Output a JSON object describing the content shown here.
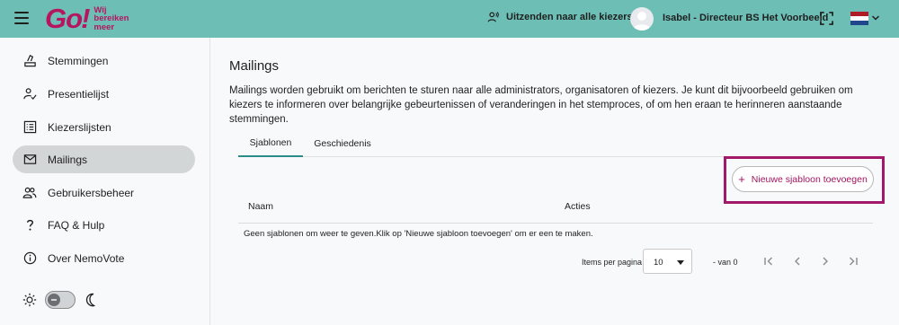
{
  "header": {
    "logo_main": "Go",
    "logo_bang": "!",
    "logo_tagline": [
      "Wij",
      "bereiken",
      "meer"
    ],
    "broadcast_label": "Uitzenden naar alle kiezers",
    "user_name": "Isabel - Directeur BS Het Voorbeeld",
    "language": "nl",
    "colors": {
      "bar": "#6dbfb6",
      "brand": "#b6155f"
    }
  },
  "sidebar": {
    "items": [
      {
        "label": "Stemmingen",
        "icon": "ballot-icon",
        "active": false
      },
      {
        "label": "Presentielijst",
        "icon": "checklist-person-icon",
        "active": false
      },
      {
        "label": "Kiezerslijsten",
        "icon": "list-box-icon",
        "active": false
      },
      {
        "label": "Mailings",
        "icon": "mail-icon",
        "active": true
      },
      {
        "label": "Gebruikersbeheer",
        "icon": "people-icon",
        "active": false
      },
      {
        "label": "FAQ & Hulp",
        "icon": "question-icon",
        "active": false
      },
      {
        "label": "Over NemoVote",
        "icon": "info-icon",
        "active": false
      }
    ],
    "theme": {
      "light_icon": "sun-icon",
      "dark_icon": "moon-icon"
    }
  },
  "main": {
    "title": "Mailings",
    "description": "Mailings worden gebruikt om berichten te sturen naar alle administrators, organisatoren of kiezers. Je kunt dit bijvoorbeeld gebruiken om kiezers te informeren over belangrijke gebeurtenissen of veranderingen in het stemproces, of om hen eraan te herinneren aanstaande stemmingen.",
    "tabs": [
      {
        "label": "Sjablonen",
        "active": true
      },
      {
        "label": "Geschiedenis",
        "active": false
      }
    ],
    "add_button": {
      "icon": "+",
      "label": "Nieuwe sjabloon toevoegen"
    },
    "table": {
      "columns": [
        "Naam",
        "Acties"
      ],
      "empty_message": "Geen sjablonen om weer te geven.Klik op 'Nieuwe sjabloon toevoegen' om er een te maken."
    },
    "pagination": {
      "per_page_label": "Items per pagina",
      "per_page_value": "10",
      "range_text": "- van 0"
    }
  }
}
